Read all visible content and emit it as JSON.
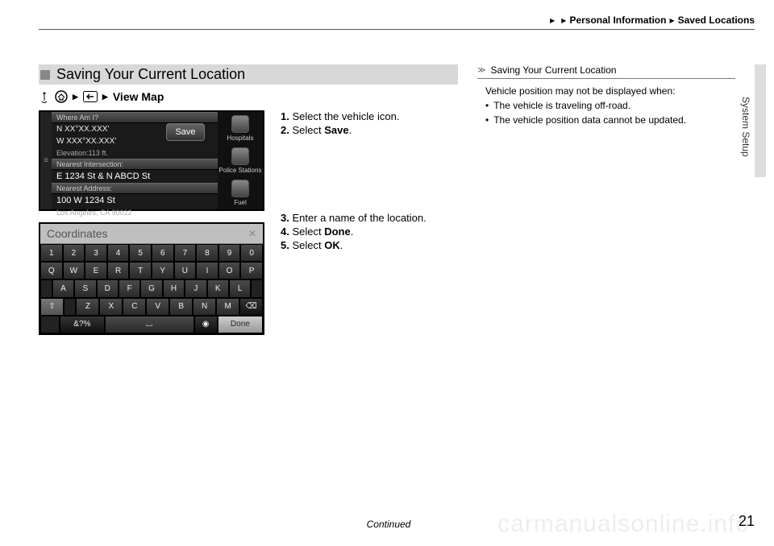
{
  "header": {
    "breadcrumb1": "Personal Information",
    "breadcrumb2": "Saved Locations"
  },
  "side_label": "System Setup",
  "section_title": "Saving Your Current Location",
  "nav_breadcrumb_end": "View Map",
  "steps_a": [
    {
      "num": "1.",
      "text_pre": "Select the vehicle icon.",
      "bold": ""
    },
    {
      "num": "2.",
      "text_pre": "Select ",
      "bold": "Save",
      "text_post": "."
    }
  ],
  "steps_b": [
    {
      "num": "3.",
      "text_pre": "Enter a name of the location.",
      "bold": ""
    },
    {
      "num": "4.",
      "text_pre": "Select ",
      "bold": "Done",
      "text_post": "."
    },
    {
      "num": "5.",
      "text_pre": "Select ",
      "bold": "OK",
      "text_post": "."
    }
  ],
  "screenshot1": {
    "title": "Where Am I?",
    "lat": "N XX°XX.XXX'",
    "lon": "W XXX°XX.XXX'",
    "elev": "Elevation:113 ft.",
    "save_btn": "Save",
    "nearest_intersection_label": "Nearest Intersection:",
    "nearest_intersection": "E 1234 St & N ABCD St",
    "nearest_address_label": "Nearest Address:",
    "nearest_address_line1": "100 W 1234 St",
    "nearest_address_line2": "Los Angeles, CA 90012",
    "side": [
      "Hospitals",
      "Police Stations",
      "Fuel"
    ]
  },
  "screenshot2": {
    "field_label": "Coordinates",
    "rows": {
      "r1": [
        "1",
        "2",
        "3",
        "4",
        "5",
        "6",
        "7",
        "8",
        "9",
        "0"
      ],
      "r2": [
        "Q",
        "W",
        "E",
        "R",
        "T",
        "Y",
        "U",
        "I",
        "O",
        "P"
      ],
      "r3": [
        "A",
        "S",
        "D",
        "F",
        "G",
        "H",
        "J",
        "K",
        "L"
      ],
      "r4_shift": "⇧",
      "r4": [
        "Z",
        "X",
        "C",
        "V",
        "B",
        "N",
        "M"
      ],
      "r4_back": "⌫",
      "r5_sym": "&?%",
      "r5_space": "⌴",
      "r5_mic": "◉",
      "r5_done": "Done"
    }
  },
  "notes": {
    "title": "Saving Your Current Location",
    "lines": [
      "Vehicle position may not be displayed when:"
    ],
    "bullets": [
      "The vehicle is traveling off-road.",
      "The vehicle position data cannot be updated."
    ]
  },
  "footer": {
    "continued": "Continued",
    "page": "21"
  },
  "watermark": "carmanualsonline.info"
}
